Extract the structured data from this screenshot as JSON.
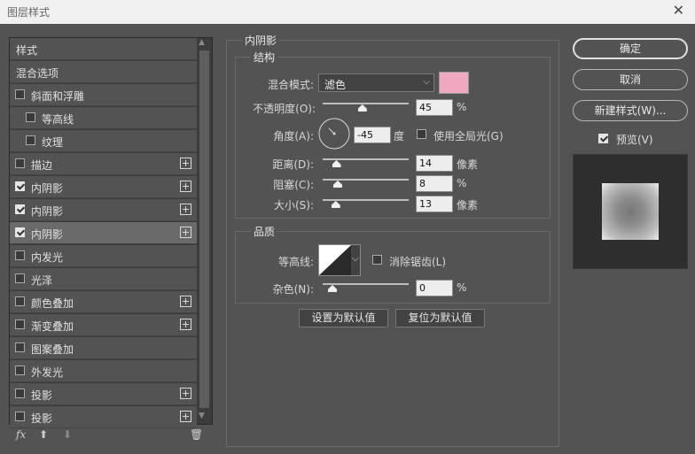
{
  "window": {
    "title": "图层样式",
    "close": "✕"
  },
  "left": {
    "items": [
      {
        "label": "样式",
        "checkbox": false,
        "checked": false,
        "indent": 0,
        "plus": false,
        "selected": false
      },
      {
        "label": "混合选项",
        "checkbox": false,
        "checked": false,
        "indent": 0,
        "plus": false,
        "selected": false
      },
      {
        "label": "斜面和浮雕",
        "checkbox": true,
        "checked": false,
        "indent": 0,
        "plus": false,
        "selected": false
      },
      {
        "label": "等高线",
        "checkbox": true,
        "checked": false,
        "indent": 1,
        "plus": false,
        "selected": false
      },
      {
        "label": "纹理",
        "checkbox": true,
        "checked": false,
        "indent": 1,
        "plus": false,
        "selected": false
      },
      {
        "label": "描边",
        "checkbox": true,
        "checked": false,
        "indent": 0,
        "plus": true,
        "selected": false
      },
      {
        "label": "内阴影",
        "checkbox": true,
        "checked": true,
        "indent": 0,
        "plus": true,
        "selected": false
      },
      {
        "label": "内阴影",
        "checkbox": true,
        "checked": true,
        "indent": 0,
        "plus": true,
        "selected": false
      },
      {
        "label": "内阴影",
        "checkbox": true,
        "checked": true,
        "indent": 0,
        "plus": true,
        "selected": true
      },
      {
        "label": "内发光",
        "checkbox": true,
        "checked": false,
        "indent": 0,
        "plus": false,
        "selected": false
      },
      {
        "label": "光泽",
        "checkbox": true,
        "checked": false,
        "indent": 0,
        "plus": false,
        "selected": false
      },
      {
        "label": "颜色叠加",
        "checkbox": true,
        "checked": false,
        "indent": 0,
        "plus": true,
        "selected": false
      },
      {
        "label": "渐变叠加",
        "checkbox": true,
        "checked": false,
        "indent": 0,
        "plus": true,
        "selected": false
      },
      {
        "label": "图案叠加",
        "checkbox": true,
        "checked": false,
        "indent": 0,
        "plus": false,
        "selected": false
      },
      {
        "label": "外发光",
        "checkbox": true,
        "checked": false,
        "indent": 0,
        "plus": false,
        "selected": false
      },
      {
        "label": "投影",
        "checkbox": true,
        "checked": false,
        "indent": 0,
        "plus": true,
        "selected": false
      },
      {
        "label": "投影",
        "checkbox": true,
        "checked": false,
        "indent": 0,
        "plus": true,
        "selected": false
      }
    ],
    "footer": {
      "fx": "fx",
      "up": "⬆",
      "down": "⬇",
      "trash": "🗑"
    }
  },
  "main": {
    "section_title": "内阴影",
    "structure": {
      "title": "结构",
      "blend_mode_label": "混合模式:",
      "blend_mode_value": "滤色",
      "blend_color": "#f0a8c0",
      "opacity_label": "不透明度(O):",
      "opacity_value": "45",
      "opacity_unit": "%",
      "opacity_fraction": 0.45,
      "angle_label": "角度(A):",
      "angle_value": "-45",
      "angle_unit": "度",
      "global_light_label": "使用全局光(G)",
      "distance_label": "距离(D):",
      "distance_value": "14",
      "distance_unit": "像素",
      "distance_fraction": 0.06,
      "choke_label": "阻塞(C):",
      "choke_value": "8",
      "choke_unit": "%",
      "choke_fraction": 0.08,
      "size_label": "大小(S):",
      "size_value": "13",
      "size_unit": "像素",
      "size_fraction": 0.05
    },
    "quality": {
      "title": "品质",
      "contour_label": "等高线:",
      "antialias_label": "消除锯齿(L)",
      "noise_label": "杂色(N):",
      "noise_value": "0",
      "noise_unit": "%",
      "noise_fraction": 0.0
    },
    "make_default": "设置为默认值",
    "reset_default": "复位为默认值"
  },
  "right": {
    "ok": "确定",
    "cancel": "取消",
    "new_style": "新建样式(W)...",
    "preview_label": "预览(V)",
    "preview_checked": true
  }
}
